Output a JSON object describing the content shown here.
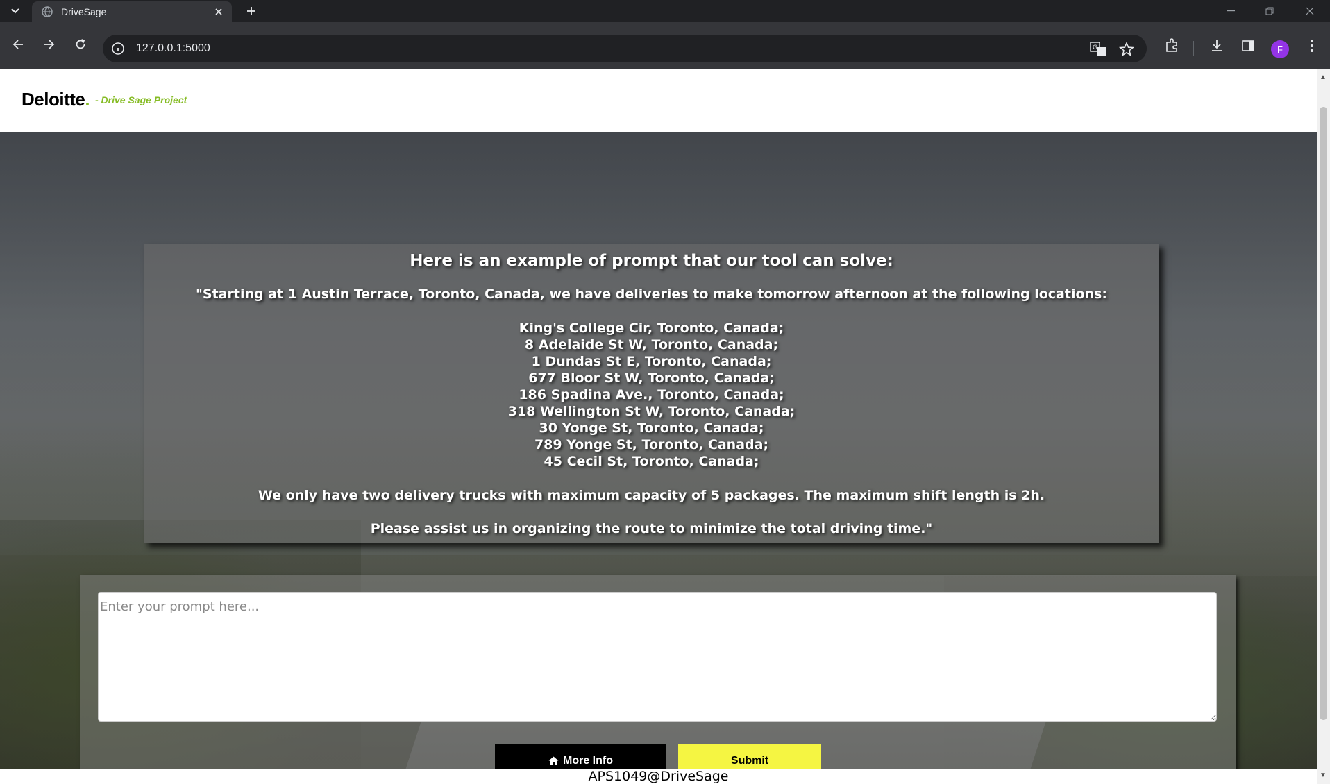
{
  "browser": {
    "tab_title": "DriveSage",
    "url": "127.0.0.1:5000",
    "profile_initial": "F",
    "icons": [
      "tab-list-icon",
      "globe-icon",
      "close-icon",
      "plus-icon",
      "minimize-icon",
      "restore-icon",
      "close-window-icon",
      "back-icon",
      "forward-icon",
      "reload-icon",
      "site-info-icon",
      "translate-icon",
      "bookmark-star-icon",
      "extensions-icon",
      "download-icon",
      "side-panel-icon",
      "more-menu-icon"
    ]
  },
  "header": {
    "logo": "Deloitte",
    "logo_dot": ".",
    "subtitle": "- Drive Sage Project"
  },
  "example": {
    "title": "Here is an example of prompt that our tool can solve:",
    "intro": "\"Starting at 1 Austin Terrace, Toronto, Canada, we have deliveries to make tomorrow afternoon at the following locations:",
    "addresses": [
      "King's College Cir, Toronto, Canada;",
      "8 Adelaide St W, Toronto, Canada;",
      "1 Dundas St E, Toronto, Canada;",
      "677 Bloor St W, Toronto, Canada;",
      "186 Spadina Ave., Toronto, Canada;",
      "318 Wellington St W, Toronto, Canada;",
      "30 Yonge St, Toronto, Canada;",
      "789 Yonge St, Toronto, Canada;",
      "45 Cecil St, Toronto, Canada;"
    ],
    "note": "We only have two delivery trucks with maximum capacity of 5 packages. The maximum shift length is 2h.",
    "ask": "Please assist us in organizing the route to minimize the total driving time.\""
  },
  "form": {
    "prompt_placeholder": "Enter your prompt here...",
    "prompt_value": "",
    "more_info_label": "More Info",
    "submit_label": "Submit"
  },
  "footer": {
    "text": "APS1049@DriveSage"
  },
  "colors": {
    "accent_green": "#86bc25",
    "submit_yellow": "#f5f542",
    "more_info_bg": "#000000"
  }
}
